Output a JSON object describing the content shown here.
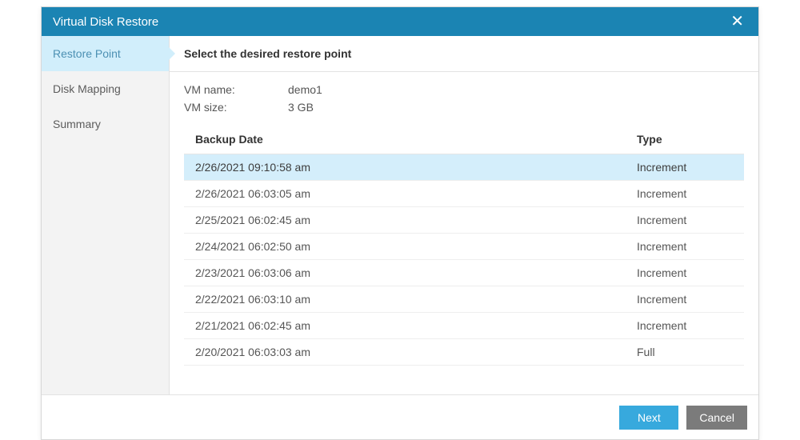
{
  "dialog": {
    "title": "Virtual Disk Restore",
    "close_glyph": "✕"
  },
  "sidebar": {
    "items": [
      {
        "label": "Restore Point",
        "active": true
      },
      {
        "label": "Disk Mapping",
        "active": false
      },
      {
        "label": "Summary",
        "active": false
      }
    ]
  },
  "main": {
    "heading": "Select the desired restore point",
    "info": {
      "vm_name_label": "VM name:",
      "vm_name_value": "demo1",
      "vm_size_label": "VM size:",
      "vm_size_value": "3 GB"
    },
    "table": {
      "headers": {
        "date": "Backup Date",
        "type": "Type"
      },
      "rows": [
        {
          "date": "2/26/2021 09:10:58 am",
          "type": "Increment",
          "selected": true
        },
        {
          "date": "2/26/2021 06:03:05 am",
          "type": "Increment",
          "selected": false
        },
        {
          "date": "2/25/2021 06:02:45 am",
          "type": "Increment",
          "selected": false
        },
        {
          "date": "2/24/2021 06:02:50 am",
          "type": "Increment",
          "selected": false
        },
        {
          "date": "2/23/2021 06:03:06 am",
          "type": "Increment",
          "selected": false
        },
        {
          "date": "2/22/2021 06:03:10 am",
          "type": "Increment",
          "selected": false
        },
        {
          "date": "2/21/2021 06:02:45 am",
          "type": "Increment",
          "selected": false
        },
        {
          "date": "2/20/2021 06:03:03 am",
          "type": "Full",
          "selected": false
        }
      ]
    }
  },
  "footer": {
    "next_label": "Next",
    "cancel_label": "Cancel"
  }
}
